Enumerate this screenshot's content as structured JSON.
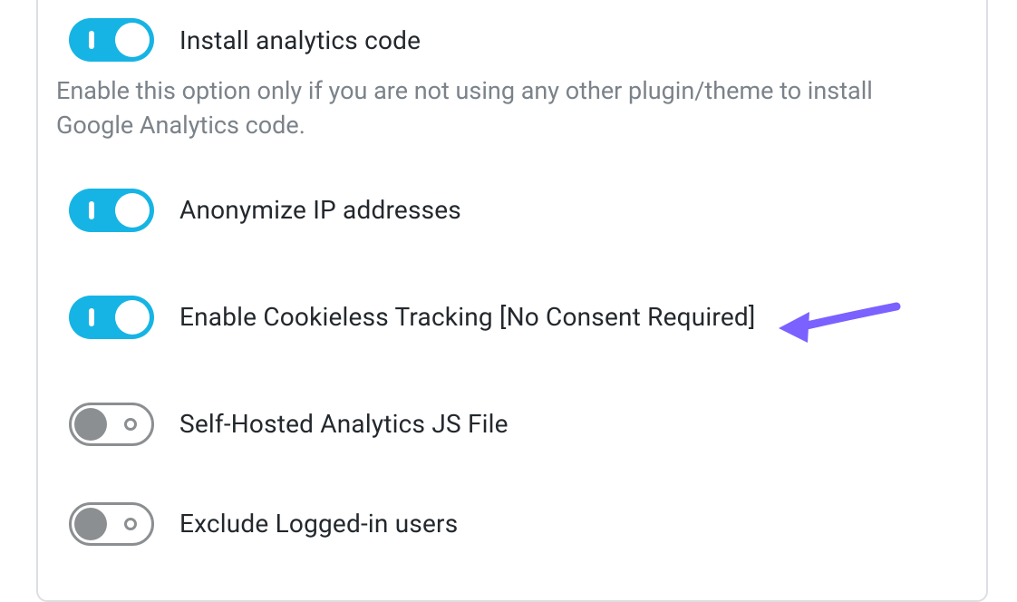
{
  "settings": [
    {
      "key": "install_analytics",
      "label": "Install analytics code",
      "enabled": true,
      "description": "Enable this option only if you are not using any other plugin/theme to install Google Analytics code."
    },
    {
      "key": "anonymize_ip",
      "label": "Anonymize IP addresses",
      "enabled": true
    },
    {
      "key": "cookieless_tracking",
      "label": "Enable Cookieless Tracking [No Consent Required]",
      "enabled": true
    },
    {
      "key": "self_hosted_js",
      "label": "Self-Hosted Analytics JS File",
      "enabled": false
    },
    {
      "key": "exclude_logged_in",
      "label": "Exclude Logged-in users",
      "enabled": false
    }
  ],
  "colors": {
    "toggle_on": "#16b4e5",
    "toggle_off_border": "#8c8f91",
    "arrow": "#7b61ff"
  }
}
